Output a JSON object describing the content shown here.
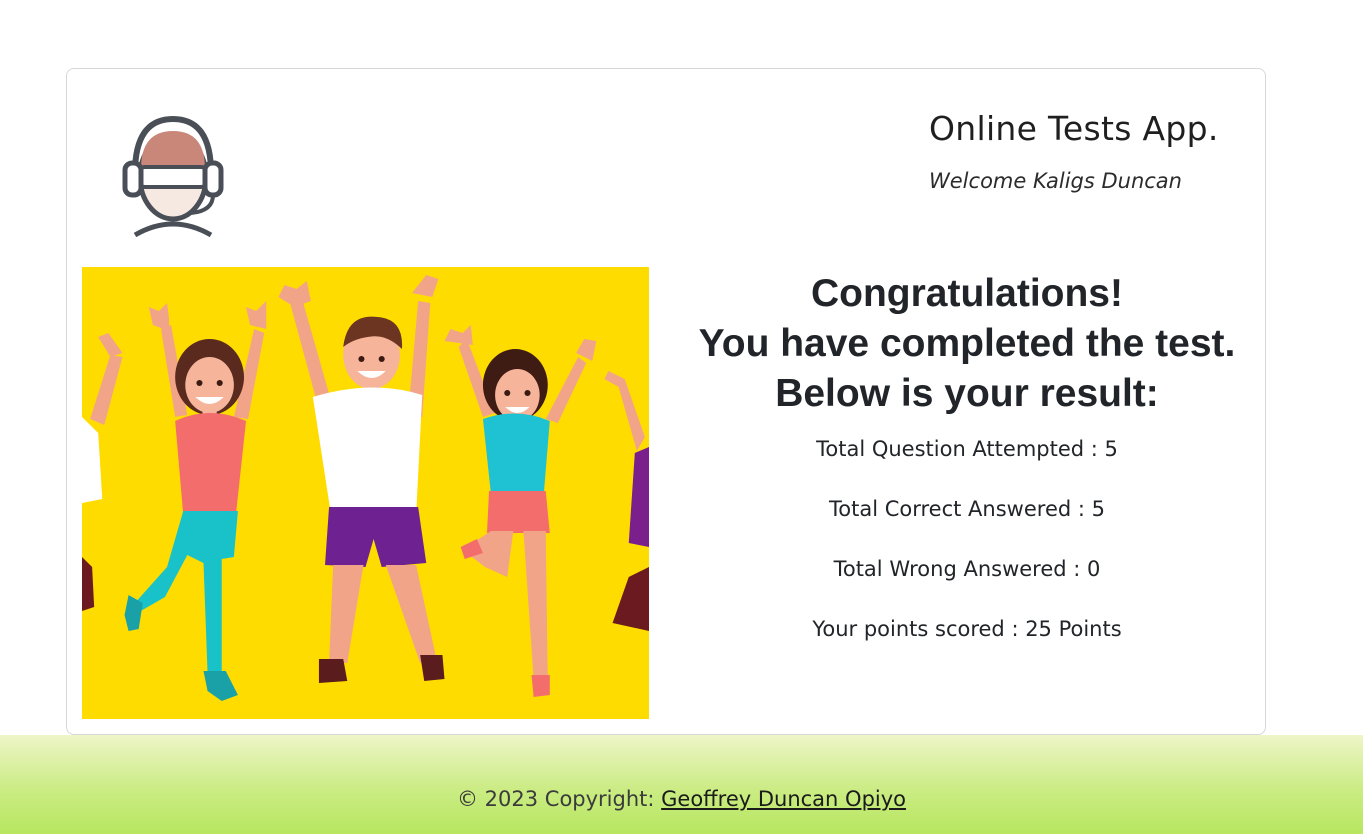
{
  "header": {
    "app_title": "Online Tests App.",
    "welcome": "Welcome Kaligs Duncan"
  },
  "result": {
    "heading_lines": [
      "Congratulations!",
      "You have completed the test.",
      "Below is your result:"
    ],
    "stats": [
      "Total Question Attempted : 5",
      "Total Correct Answered : 5",
      "Total Wrong Answered : 0",
      "Your points scored : 25 Points"
    ]
  },
  "footer": {
    "prefix": "© 2023 Copyright: ",
    "author_link": "Geoffrey Duncan Opiyo"
  },
  "icons": {
    "avatar": "headset-avatar-icon",
    "illustration": "celebrating-people-illustration"
  },
  "colors": {
    "illustration_background": "#ffdc00",
    "footer_gradient_top": "#eef5c8",
    "footer_gradient_bottom": "#b7e65f"
  }
}
